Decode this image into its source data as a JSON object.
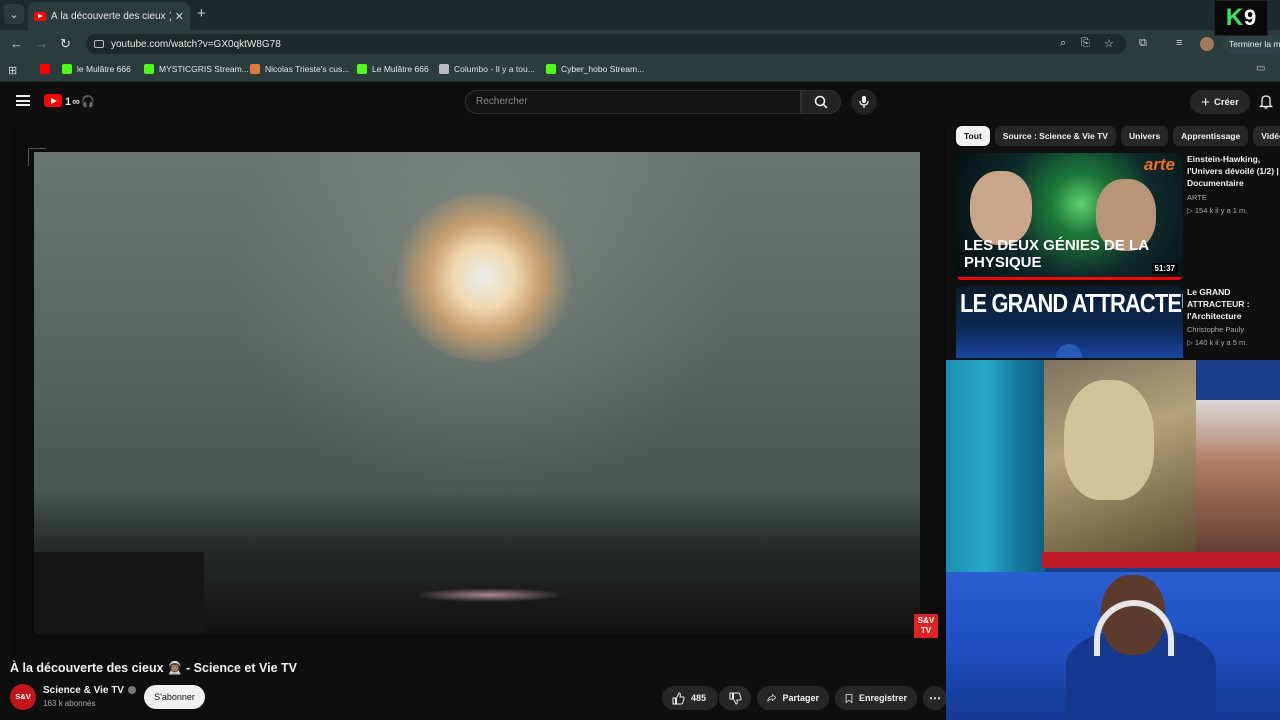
{
  "browser": {
    "tab_title": "À la découverte des cieux 👨🏽‍🚀 🔊",
    "url": "youtube.com/watch?v=GX0qktW8G78",
    "finish_label": "Terminer la m",
    "bookmarks": [
      {
        "label": "",
        "color": "#ff0000"
      },
      {
        "label": "le Mulâtre 666",
        "color": "#53fc18"
      },
      {
        "label": "MYSTICGRIS Stream...",
        "color": "#53fc18"
      },
      {
        "label": "Nicolas Trieste's cus...",
        "color": "#e07a3a"
      },
      {
        "label": "Le Mulâtre 666",
        "color": "#53fc18"
      },
      {
        "label": "Columbo - Il y a tou...",
        "color": "#bbbbbb"
      },
      {
        "label": "Cyber_hobo Stream...",
        "color": "#53fc18"
      }
    ]
  },
  "overlay": {
    "k9_letter": "K",
    "k9_number": "9"
  },
  "youtube": {
    "logo_doodle": "1∞🎧",
    "search_placeholder": "Rechercher",
    "create_label": "Créer"
  },
  "video": {
    "title": "À la découverte des cieux 👨🏽‍🚀 - Science et Vie TV",
    "watermark": "S&V TV",
    "channel": {
      "avatar_text": "S&V",
      "name": "Science & Vie TV",
      "subscribers": "163 k abonnés",
      "subscribe_label": "S'abonner"
    },
    "actions": {
      "likes": "485",
      "share_label": "Partager",
      "save_label": "Enregistrer"
    }
  },
  "sidebar": {
    "chips": [
      "Tout",
      "Source : Science & Vie TV",
      "Univers",
      "Apprentissage",
      "Vidéos s"
    ],
    "recommendations": [
      {
        "thumb_caption": "LES DEUX GÉNIES DE LA PHYSIQUE",
        "thumb_brand": "arte",
        "duration": "51:37",
        "title": "Einstein-Hawking, l'Univers dévoilé (1/2) | Documentaire",
        "channel": "ARTE",
        "meta": "▷ 154 k  il y a 1 m."
      },
      {
        "thumb_caption": "LE GRAND ATTRACTEUR",
        "title": "Le GRAND ATTRACTEUR : l'Architecture INVISIBLE qui nous emporte",
        "channel": "Christophe Pauly",
        "meta": "▷ 140 k  il y a 5 m."
      }
    ]
  }
}
